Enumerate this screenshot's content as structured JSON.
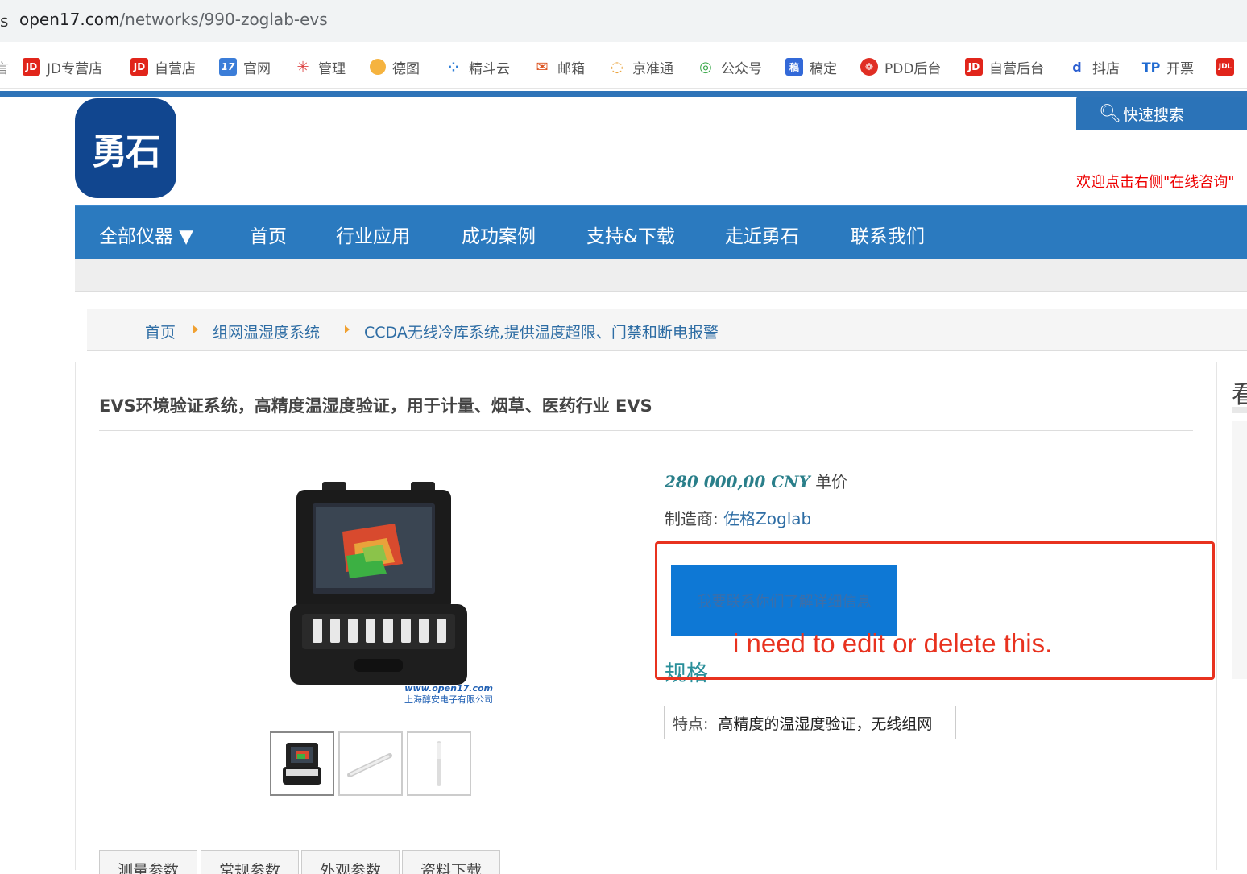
{
  "browser": {
    "lead_char": "s",
    "url_host": "open17.com",
    "url_path": "/networks/990-zoglab-evs"
  },
  "bookmarks": [
    {
      "label": "JD专营店",
      "icon": "jd-icon",
      "icon_text": "JD"
    },
    {
      "label": "自营店",
      "icon": "jd-icon",
      "icon_text": "JD"
    },
    {
      "label": "官网",
      "icon": "open17-icon",
      "icon_text": "17"
    },
    {
      "label": "管理",
      "icon": "joomla-icon",
      "icon_text": "✳"
    },
    {
      "label": "德图",
      "icon": "orange-dot-icon",
      "icon_text": ""
    },
    {
      "label": "精斗云",
      "icon": "jdy-icon",
      "icon_text": "⁘"
    },
    {
      "label": "邮箱",
      "icon": "mail-icon",
      "icon_text": "✉"
    },
    {
      "label": "京准通",
      "icon": "ring-icon",
      "icon_text": "◌"
    },
    {
      "label": "公众号",
      "icon": "wechat-mp-icon",
      "icon_text": "◎"
    },
    {
      "label": "稿定",
      "icon": "gaoding-icon",
      "icon_text": "稿"
    },
    {
      "label": "PDD后台",
      "icon": "pdd-icon",
      "icon_text": "❁"
    },
    {
      "label": "自营后台",
      "icon": "jd-icon",
      "icon_text": "JD"
    },
    {
      "label": "抖店",
      "icon": "doudian-icon",
      "icon_text": "d"
    },
    {
      "label": "开票",
      "icon": "invoice-icon",
      "icon_text": "TP"
    },
    {
      "label": "",
      "icon": "jdl-icon",
      "icon_text": "JDL"
    }
  ],
  "site": {
    "logo_text": "勇石",
    "quick_search": "快速搜索",
    "welcome": "欢迎点击右侧\"在线咨询\"",
    "nav": [
      "全部仪器 ▼",
      "首页",
      "行业应用",
      "成功案例",
      "支持&下载",
      "走近勇石",
      "联系我们"
    ]
  },
  "breadcrumb": [
    "首页",
    "组网温湿度系统",
    "CCDA无线冷库系统,提供温度超限、门禁和断电报警"
  ],
  "product": {
    "title": "EVS环境验证系统，高精度温湿度验证，用于计量、烟草、医药行业 EVS",
    "price": "280 000,00 CNY",
    "price_unit": "单价",
    "manufacturer_label": "制造商:",
    "manufacturer": "佐格Zoglab",
    "contact_button": "我要联系你们了解详细信息",
    "spec_title": "规格",
    "feature_key": "特点:",
    "feature_value": "高精度的温湿度验证，无线组网",
    "image_watermark_1": "www.open17.com",
    "image_watermark_2": "上海醇安电子有限公司"
  },
  "annotation": "i need to edit or delete this.",
  "tabs": [
    "测量参数",
    "常规参数",
    "外观参数",
    "资料下载"
  ],
  "sidebar": {
    "heading": "看"
  },
  "colors": {
    "nav_blue": "#2b7abf",
    "logo_blue": "#11468f",
    "button_blue": "#0e78d5",
    "annotation_red": "#e8321f",
    "price_teal": "#2a7f8a"
  }
}
